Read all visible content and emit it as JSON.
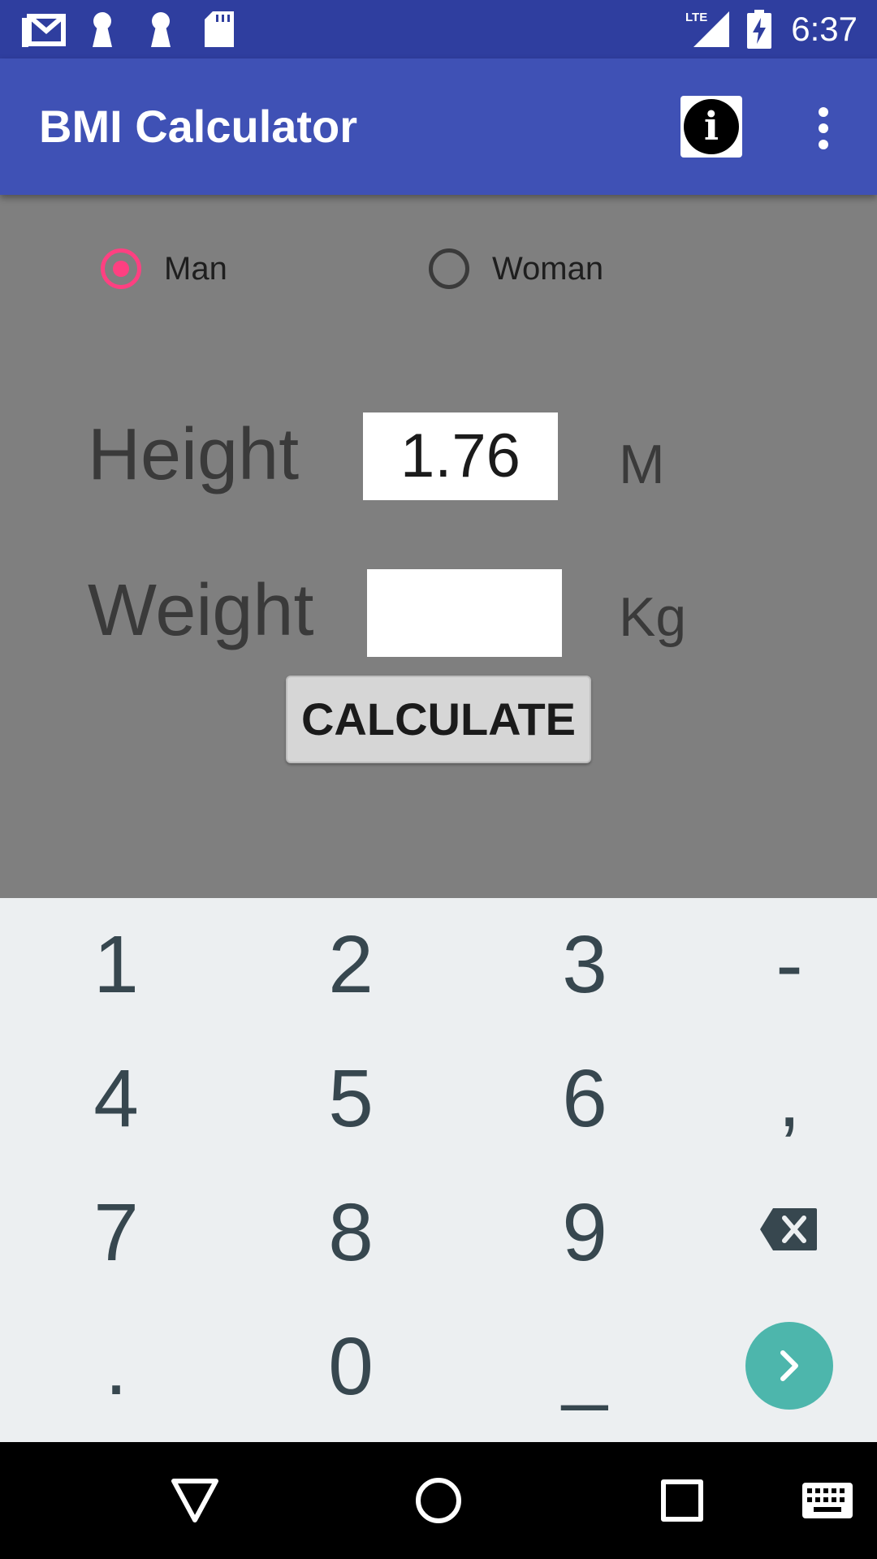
{
  "status_bar": {
    "time": "6:37",
    "network": "LTE",
    "icons": [
      "gmail-icon",
      "keyhole-icon",
      "keyhole-icon",
      "sd-card-icon",
      "lte-signal-icon",
      "battery-charging-icon"
    ]
  },
  "app_bar": {
    "title": "BMI Calculator",
    "info_label": "i",
    "icons": [
      "info-icon",
      "overflow-menu-icon"
    ]
  },
  "gender": {
    "options": [
      {
        "label": "Man",
        "selected": true
      },
      {
        "label": "Woman",
        "selected": false
      }
    ],
    "accent_color": "#ff4081"
  },
  "form": {
    "height_label": "Height",
    "height_value": "1.76",
    "height_unit": "M",
    "weight_label": "Weight",
    "weight_value": "",
    "weight_unit": "Kg",
    "calculate_label": "CALCULATE"
  },
  "keyboard": {
    "rows": [
      [
        "1",
        "2",
        "3",
        "-"
      ],
      [
        "4",
        "5",
        "6",
        ","
      ],
      [
        "7",
        "8",
        "9",
        "backspace"
      ],
      [
        ".",
        "0",
        "_",
        "next"
      ]
    ],
    "icons": [
      "backspace-icon",
      "next-arrow-icon"
    ],
    "action_color": "#4db6ac"
  },
  "nav_bar": {
    "icons": [
      "back-icon",
      "home-icon",
      "recents-icon",
      "keyboard-icon"
    ]
  },
  "colors": {
    "status_bar": "#2f3e9f",
    "app_bar": "#3f51b5",
    "content_background": "#7f7f7f",
    "keyboard_background": "#eceff1"
  }
}
